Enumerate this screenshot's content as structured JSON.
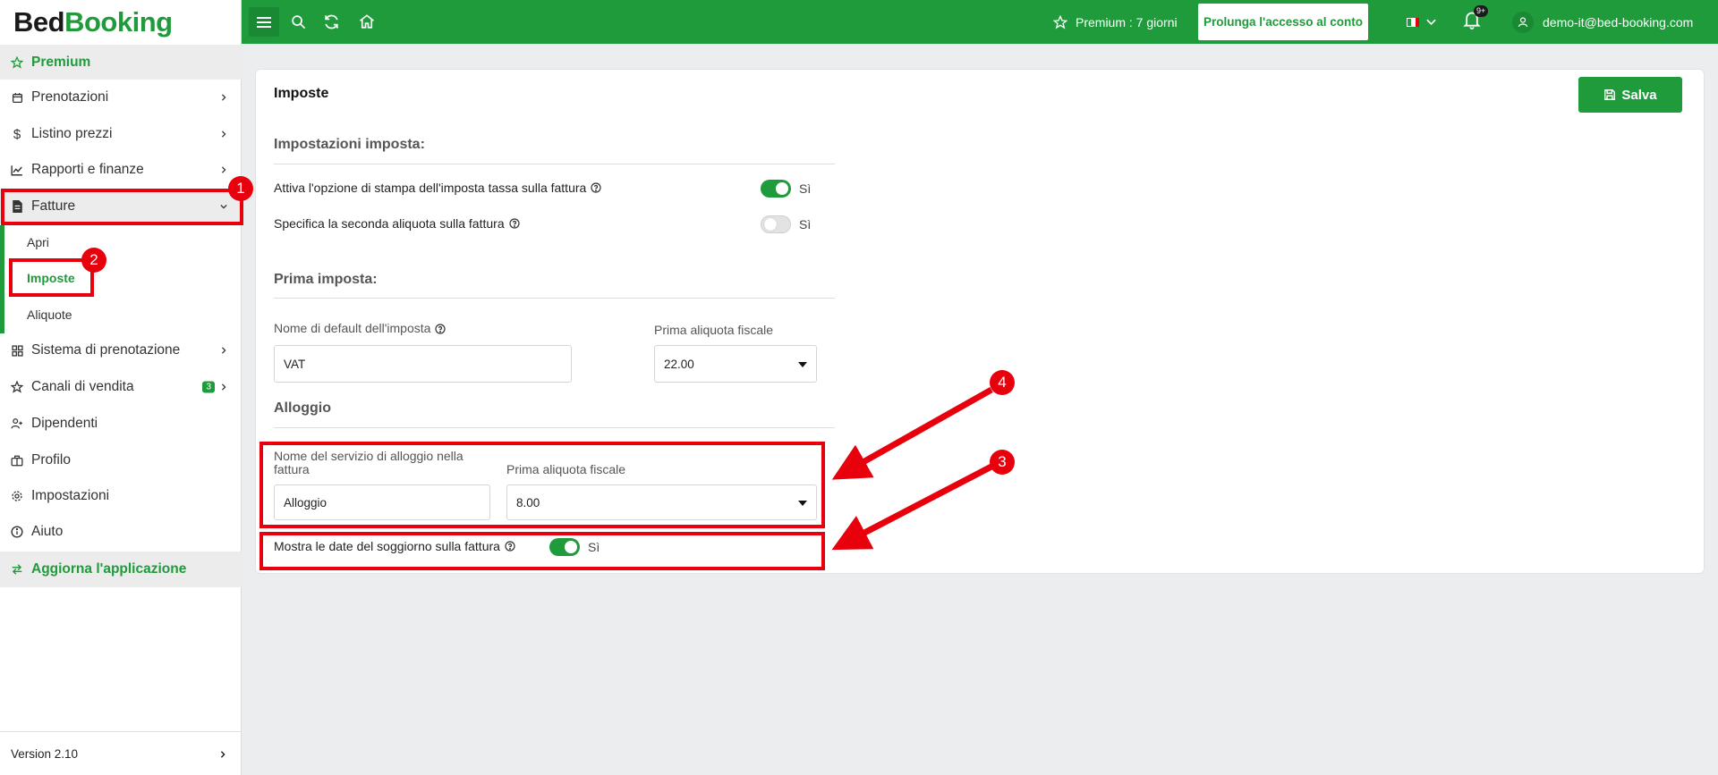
{
  "logo": {
    "part1": "Bed",
    "part2": "Booking"
  },
  "sidebar": {
    "premium": "Premium",
    "items": [
      {
        "label": "Prenotazioni",
        "icon": "calendar-icon"
      },
      {
        "label": "Listino prezzi",
        "icon": "dollar-icon"
      },
      {
        "label": "Rapporti e finanze",
        "icon": "chart-icon"
      },
      {
        "label": "Fatture",
        "icon": "invoice-icon"
      },
      {
        "label": "Sistema di prenotazione",
        "icon": "grid-icon"
      },
      {
        "label": "Canali di vendita",
        "icon": "star-icon",
        "badge": "3"
      },
      {
        "label": "Dipendenti",
        "icon": "user-plus-icon"
      },
      {
        "label": "Profilo",
        "icon": "briefcase-icon"
      },
      {
        "label": "Impostazioni",
        "icon": "gear-icon"
      },
      {
        "label": "Aiuto",
        "icon": "info-icon"
      }
    ],
    "fatture_sub": [
      "Apri",
      "Imposte",
      "Aliquote"
    ],
    "update": "Aggiorna l'applicazione",
    "version": "Version 2.10"
  },
  "topbar": {
    "premium_info": "Premium : 7 giorni",
    "extend_label": "Prolunga l'accesso al conto",
    "notif_count": "9+",
    "user_email": "demo-it@bed-booking.com"
  },
  "card": {
    "title": "Imposte",
    "save_label": "Salva",
    "section1": "Impostazioni imposta:",
    "opt_print": "Attiva l'opzione di stampa dell'imposta tassa sulla fattura",
    "opt_second": "Specifica la seconda aliquota sulla fattura",
    "yes": "Sì",
    "section2": "Prima imposta:",
    "default_name_label": "Nome di default dell'imposta",
    "default_name_value": "VAT",
    "first_rate_label": "Prima aliquota fiscale",
    "first_rate_value": "22.00",
    "section3": "Alloggio",
    "lodging_name_label": "Nome del servizio di alloggio nella fattura",
    "lodging_name_value": "Alloggio",
    "lodging_rate_label": "Prima aliquota fiscale",
    "lodging_rate_value": "8.00",
    "show_dates": "Mostra le date del soggiorno sulla fattura"
  },
  "annotations": [
    "1",
    "2",
    "3",
    "4"
  ],
  "colors": {
    "brand": "#1f9b3b",
    "annotation": "#e8000d"
  }
}
